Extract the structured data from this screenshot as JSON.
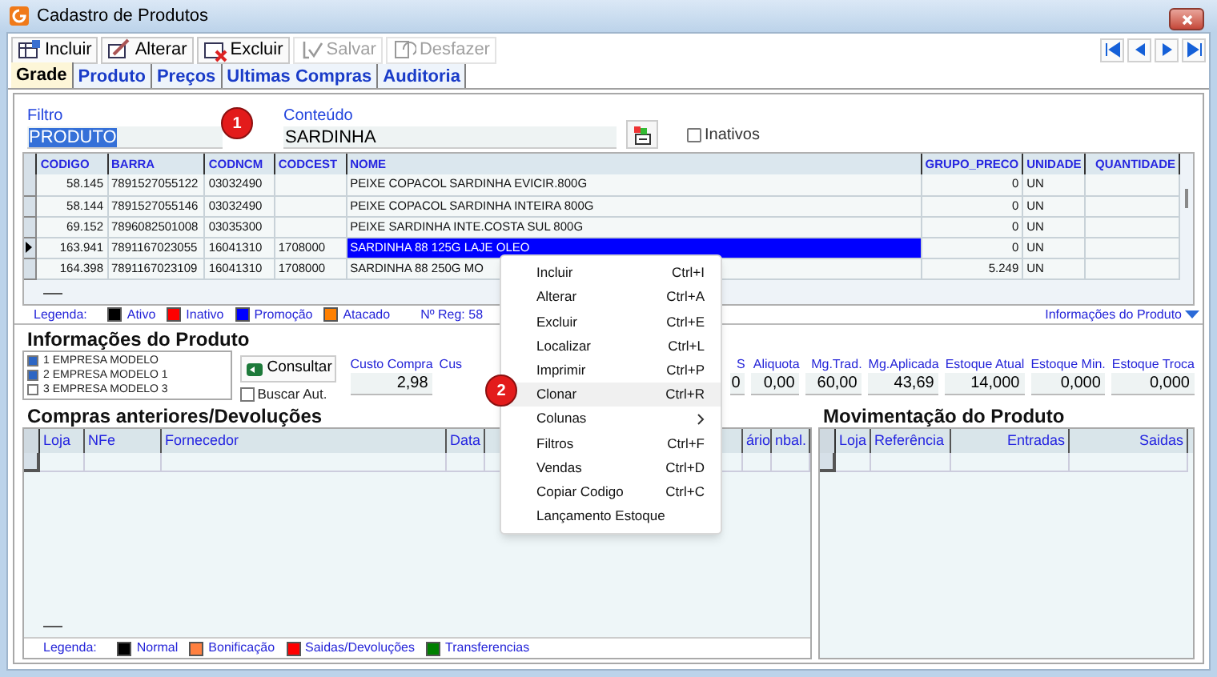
{
  "window": {
    "title": "Cadastro de Produtos"
  },
  "toolbar": {
    "buttons": [
      {
        "label": "Incluir",
        "disabled": false
      },
      {
        "label": "Alterar",
        "disabled": false
      },
      {
        "label": "Excluir",
        "disabled": false
      },
      {
        "label": "Salvar",
        "disabled": true
      },
      {
        "label": "Desfazer",
        "disabled": true
      }
    ]
  },
  "tabs": [
    {
      "label": "Grade",
      "selected": true
    },
    {
      "label": "Produto",
      "selected": false
    },
    {
      "label": "Preços",
      "selected": false
    },
    {
      "label": "Ultimas Compras",
      "selected": false
    },
    {
      "label": "Auditoria",
      "selected": false
    }
  ],
  "filter": {
    "filtro_label": "Filtro",
    "filtro_value": "PRODUTO",
    "conteudo_label": "Conteúdo",
    "conteudo_value": "SARDINHA",
    "inativos": {
      "label": "Inativos",
      "checked": false
    }
  },
  "grid": {
    "columns": [
      "CODIGO",
      "BARRA",
      "CODNCM",
      "CODCEST",
      "NOME",
      "GRUPO_PRECO",
      "UNIDADE",
      "QUANTIDADE"
    ],
    "rows": [
      {
        "cells": [
          "58.145",
          "7891527055122",
          "03032490",
          "",
          "PEIXE COPACOL SARDINHA EVICIR.800G",
          "0",
          "UN",
          ""
        ],
        "selected": false
      },
      {
        "cells": [
          "58.144",
          "7891527055146",
          "03032490",
          "",
          "PEIXE COPACOL SARDINHA INTEIRA 800G",
          "0",
          "UN",
          ""
        ],
        "selected": false
      },
      {
        "cells": [
          "69.152",
          "7896082501008",
          "03035300",
          "",
          "PEIXE SARDINHA INTE.COSTA SUL 800G",
          "0",
          "UN",
          ""
        ],
        "selected": false
      },
      {
        "cells": [
          "163.941",
          "7891167023055",
          "16041310",
          "1708000",
          "SARDINHA 88 125G LAJE OLEO",
          "0",
          "UN",
          ""
        ],
        "selected": true
      },
      {
        "cells": [
          "164.398",
          "7891167023109",
          "16041310",
          "1708000",
          "SARDINHA 88 250G MO",
          "5.249",
          "UN",
          ""
        ],
        "selected": false
      }
    ],
    "legend": {
      "label": "Legenda:",
      "items": [
        {
          "label": "Ativo",
          "color": "#000000"
        },
        {
          "label": "Inativo",
          "color": "#ff0000"
        },
        {
          "label": "Promoção",
          "color": "#0000ff"
        },
        {
          "label": "Atacado",
          "color": "#ff8000"
        }
      ],
      "count": "Nº Reg: 58",
      "link": "Informações do Produto"
    }
  },
  "info": {
    "title": "Informações do Produto",
    "stores": [
      {
        "label": "1 EMPRESA MODELO",
        "checked": true
      },
      {
        "label": "2 EMPRESA MODELO 1",
        "checked": true
      },
      {
        "label": "3 EMPRESA MODELO 3",
        "checked": false
      }
    ],
    "consultar": "Consultar",
    "buscar_aut": {
      "label": "Buscar Aut.",
      "checked": false
    },
    "fields": [
      {
        "label": "Custo Compra",
        "value": "2,98"
      },
      {
        "label": "Cus"
      },
      {
        "label": "S",
        "value": "0"
      },
      {
        "label": "Aliquota",
        "value": "0,00"
      },
      {
        "label": "Mg.Trad.",
        "value": "60,00"
      },
      {
        "label": "Mg.Aplicada",
        "value": "43,69"
      },
      {
        "label": "Estoque Atual",
        "value": "14,000"
      },
      {
        "label": "Estoque Min.",
        "value": "0,000"
      },
      {
        "label": "Estoque Troca",
        "value": "0,000"
      }
    ]
  },
  "compras": {
    "title": "Compras anteriores/Devoluções",
    "columns": [
      "Loja",
      "NFe",
      "Fornecedor",
      "Data",
      "",
      "ário",
      "nbal."
    ],
    "legend": {
      "label": "Legenda:",
      "items": [
        {
          "label": "Normal",
          "color": "#000000"
        },
        {
          "label": "Bonificação",
          "color": "#ff8040"
        },
        {
          "label": "Saidas/Devoluções",
          "color": "#ff0000"
        },
        {
          "label": "Transferencias",
          "color": "#008000"
        }
      ]
    }
  },
  "movimentacao": {
    "title": "Movimentação do Produto",
    "columns": [
      "Loja",
      "Referência",
      "Entradas",
      "Saidas"
    ]
  },
  "context_menu": {
    "items": [
      {
        "label": "Incluir",
        "shortcut": "Ctrl+I",
        "has_submenu": false,
        "selected": false
      },
      {
        "label": "Alterar",
        "shortcut": "Ctrl+A",
        "has_submenu": false,
        "selected": false
      },
      {
        "label": "Excluir",
        "shortcut": "Ctrl+E",
        "has_submenu": false,
        "selected": false
      },
      {
        "label": "Localizar",
        "shortcut": "Ctrl+L",
        "has_submenu": false,
        "selected": false
      },
      {
        "label": "Imprimir",
        "shortcut": "Ctrl+P",
        "has_submenu": false,
        "selected": false
      },
      {
        "label": "Clonar",
        "shortcut": "Ctrl+R",
        "has_submenu": false,
        "selected": true
      },
      {
        "label": "Colunas",
        "has_submenu": true,
        "selected": false
      },
      {
        "label": "Filtros",
        "shortcut": "Ctrl+F",
        "has_submenu": false,
        "selected": false
      },
      {
        "label": "Vendas",
        "shortcut": "Ctrl+D",
        "has_submenu": false,
        "selected": false
      },
      {
        "label": "Copiar Codigo",
        "shortcut": "Ctrl+C",
        "has_submenu": false,
        "selected": false
      },
      {
        "label": "Lançamento Estoque",
        "has_submenu": false,
        "selected": false
      }
    ]
  },
  "callouts": [
    "1",
    "2"
  ]
}
